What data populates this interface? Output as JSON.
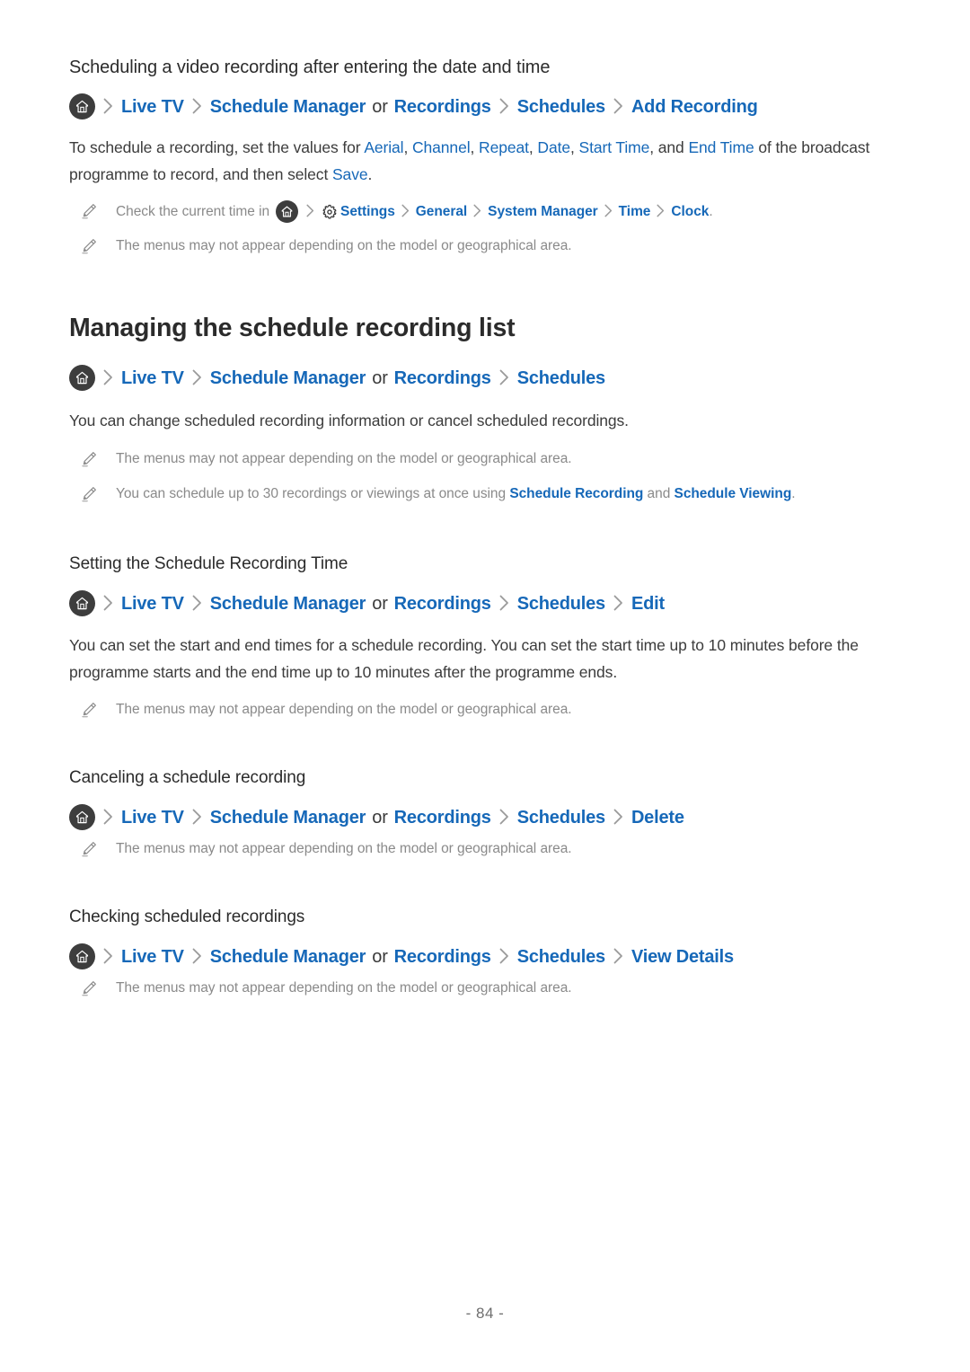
{
  "page": {
    "number_label": "- 84 -"
  },
  "icons": {
    "home": "home-icon",
    "gear": "gear-icon",
    "pencil": "pencil-icon",
    "chevron": "chevron-right-icon"
  },
  "colors": {
    "link_blue": "#1668b8",
    "body_text": "#3c3c3c",
    "note_text": "#8a8a8a",
    "heading": "#2b2b2b",
    "home_circle": "#3d3d3d",
    "separator": "#9a9a9a"
  },
  "sections": [
    {
      "id": "scheduling-video-recording",
      "heading": "Scheduling a video recording after entering the date and time",
      "path": [
        "Live TV",
        "Schedule Manager",
        "or",
        "Recordings",
        "Schedules",
        "Add Recording"
      ],
      "body": {
        "t1": "To schedule a recording, set the values for ",
        "l1": "Aerial",
        "t2": ", ",
        "l2": "Channel",
        "t3": ", ",
        "l3": "Repeat",
        "t4": ", ",
        "l4": "Date",
        "t5": ", ",
        "l5": "Start Time",
        "t6": ", and ",
        "l6": "End Time",
        "t7": " of the broadcast programme to record, and then select ",
        "l7": "Save",
        "t8": "."
      },
      "notes": {
        "clock": {
          "prefix": "Check the current time in",
          "settings": "Settings",
          "general": "General",
          "system_manager": "System Manager",
          "time": "Time",
          "clock": "Clock",
          "suffix": "."
        },
        "menus": "The menus may not appear depending on the model or geographical area."
      }
    },
    {
      "id": "managing-schedule-recording-list",
      "heading": "Managing the schedule recording list",
      "path": [
        "Live TV",
        "Schedule Manager",
        "or",
        "Recordings",
        "Schedules"
      ],
      "body": "You can change scheduled recording information or cancel scheduled recordings.",
      "notes": {
        "menus": "The menus may not appear depending on the model or geographical area.",
        "limit": {
          "t1": "You can schedule up to 30 recordings or viewings at once using ",
          "l1": "Schedule Recording",
          "t2": " and ",
          "l2": "Schedule Viewing",
          "t3": "."
        }
      }
    },
    {
      "id": "setting-schedule-recording-time",
      "heading": "Setting the Schedule Recording Time",
      "path": [
        "Live TV",
        "Schedule Manager",
        "or",
        "Recordings",
        "Schedules",
        "Edit"
      ],
      "body": "You can set the start and end times for a schedule recording. You can set the start time up to 10 minutes before the programme starts and the end time up to 10 minutes after the programme ends.",
      "notes": {
        "menus": "The menus may not appear depending on the model or geographical area."
      }
    },
    {
      "id": "canceling-schedule-recording",
      "heading": "Canceling a schedule recording",
      "path": [
        "Live TV",
        "Schedule Manager",
        "or",
        "Recordings",
        "Schedules",
        "Delete"
      ],
      "notes": {
        "menus": "The menus may not appear depending on the model or geographical area."
      }
    },
    {
      "id": "checking-scheduled-recordings",
      "heading": "Checking scheduled recordings",
      "path": [
        "Live TV",
        "Schedule Manager",
        "or",
        "Recordings",
        "Schedules",
        "View Details"
      ],
      "notes": {
        "menus": "The menus may not appear depending on the model or geographical area."
      }
    }
  ]
}
